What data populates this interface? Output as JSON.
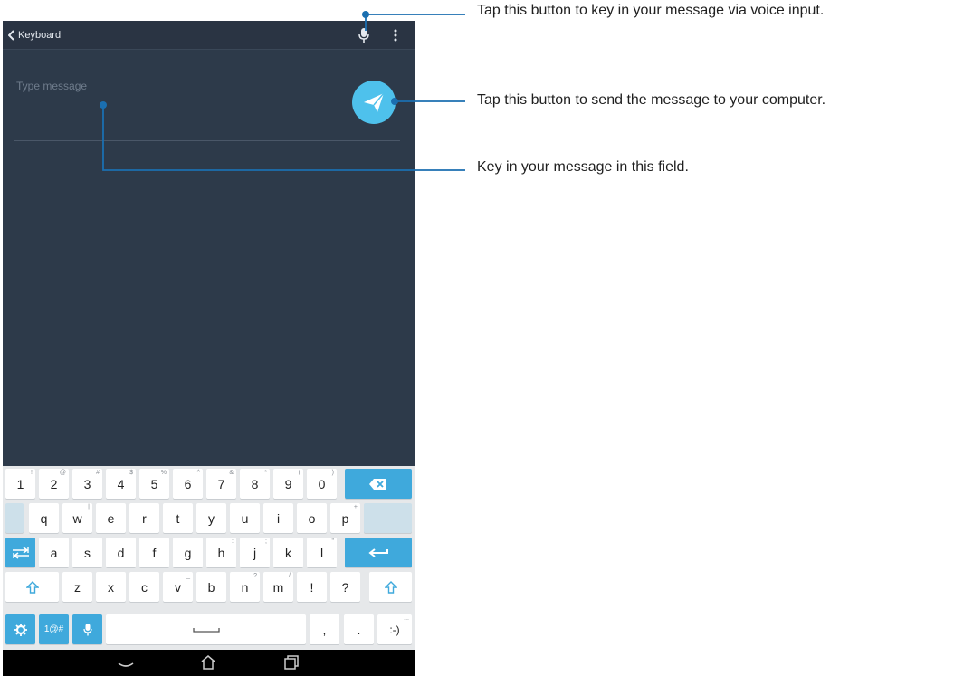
{
  "topbar": {
    "back_label": "Keyboard"
  },
  "message": {
    "placeholder": "Type message"
  },
  "keyboard": {
    "row1": [
      {
        "label": "1",
        "hint": "!"
      },
      {
        "label": "2",
        "hint": "@"
      },
      {
        "label": "3",
        "hint": "#"
      },
      {
        "label": "4",
        "hint": "$"
      },
      {
        "label": "5",
        "hint": "%"
      },
      {
        "label": "6",
        "hint": "^"
      },
      {
        "label": "7",
        "hint": "&"
      },
      {
        "label": "8",
        "hint": "*"
      },
      {
        "label": "9",
        "hint": "("
      },
      {
        "label": "0",
        "hint": ")"
      }
    ],
    "row2": [
      {
        "label": "q",
        "hint": ""
      },
      {
        "label": "w",
        "hint": "|"
      },
      {
        "label": "e",
        "hint": ""
      },
      {
        "label": "r",
        "hint": ""
      },
      {
        "label": "t",
        "hint": ""
      },
      {
        "label": "y",
        "hint": ""
      },
      {
        "label": "u",
        "hint": ""
      },
      {
        "label": "i",
        "hint": ""
      },
      {
        "label": "o",
        "hint": ""
      },
      {
        "label": "p",
        "hint": "+"
      }
    ],
    "row3": [
      {
        "label": "a",
        "hint": ""
      },
      {
        "label": "s",
        "hint": ""
      },
      {
        "label": "d",
        "hint": ""
      },
      {
        "label": "f",
        "hint": ""
      },
      {
        "label": "g",
        "hint": ""
      },
      {
        "label": "h",
        "hint": ":"
      },
      {
        "label": "j",
        "hint": ";"
      },
      {
        "label": "k",
        "hint": "'"
      },
      {
        "label": "l",
        "hint": "\""
      }
    ],
    "row4": [
      {
        "label": "z",
        "hint": ""
      },
      {
        "label": "x",
        "hint": ""
      },
      {
        "label": "c",
        "hint": ""
      },
      {
        "label": "v",
        "hint": "_"
      },
      {
        "label": "b",
        "hint": ""
      },
      {
        "label": "n",
        "hint": "?"
      },
      {
        "label": "m",
        "hint": "/"
      },
      {
        "label": "!",
        "hint": ""
      },
      {
        "label": "?",
        "hint": ""
      }
    ],
    "symbols_label": "1@#",
    "comma": ",",
    "period": ".",
    "emoji": ":-)",
    "emoji_hint": "..."
  },
  "callouts": {
    "voice": "Tap this button to key in your message via voice input.",
    "send": "Tap this button to send the message to your computer.",
    "field": "Key in your message in this field."
  },
  "colors": {
    "accent": "#3fa9dc",
    "send_button": "#4ec1ec",
    "background": "#2d3a4a",
    "callout_line": "#1b6fb0"
  }
}
